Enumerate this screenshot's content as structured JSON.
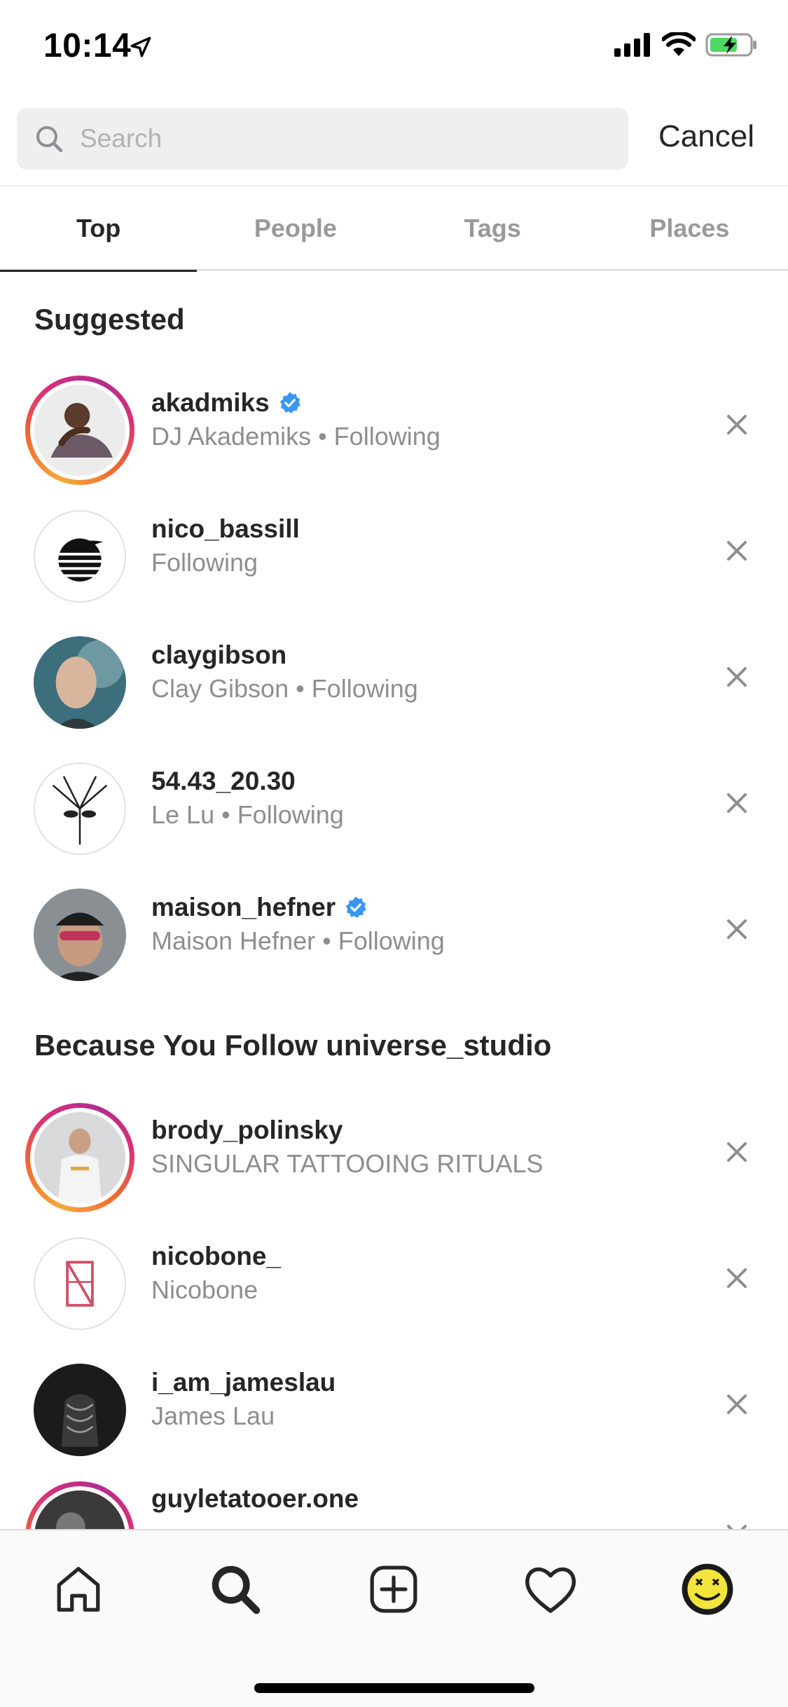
{
  "status_bar": {
    "time": "10:14"
  },
  "search": {
    "placeholder": "Search",
    "value": "",
    "cancel_label": "Cancel"
  },
  "tabs": [
    {
      "label": "Top",
      "active": true
    },
    {
      "label": "People",
      "active": false
    },
    {
      "label": "Tags",
      "active": false
    },
    {
      "label": "Places",
      "active": false
    }
  ],
  "suggested": {
    "heading": "Suggested",
    "items": [
      {
        "username": "akadmiks",
        "verified": true,
        "subtitle": "DJ Akademiks • Following",
        "story_ring": true
      },
      {
        "username": "nico_bassill",
        "verified": false,
        "subtitle": "Following",
        "story_ring": false
      },
      {
        "username": "claygibson",
        "verified": false,
        "subtitle": "Clay Gibson • Following",
        "story_ring": false
      },
      {
        "username": "54.43_20.30",
        "verified": false,
        "subtitle": "Le Lu • Following",
        "story_ring": false
      },
      {
        "username": "maison_hefner",
        "verified": true,
        "subtitle": "Maison Hefner • Following",
        "story_ring": false
      }
    ]
  },
  "because_follow": {
    "heading": "Because You Follow universe_studio",
    "items": [
      {
        "username": "brody_polinsky",
        "verified": false,
        "subtitle": "SINGULAR TATTOOING RITUALS",
        "story_ring": true
      },
      {
        "username": "nicobone_",
        "verified": false,
        "subtitle": "Nicobone",
        "story_ring": false
      },
      {
        "username": "i_am_jameslau",
        "verified": false,
        "subtitle": "James Lau",
        "story_ring": false
      },
      {
        "username": "guyletatooer.one",
        "verified": false,
        "subtitle": "",
        "story_ring": true
      }
    ]
  },
  "colors": {
    "verified_badge": "#3897f0",
    "secondary_text": "#8e8e8e",
    "primary_text": "#262626"
  },
  "nav_icons": [
    "home-icon",
    "search-icon",
    "new-post-icon",
    "activity-heart-icon",
    "profile-avatar"
  ]
}
